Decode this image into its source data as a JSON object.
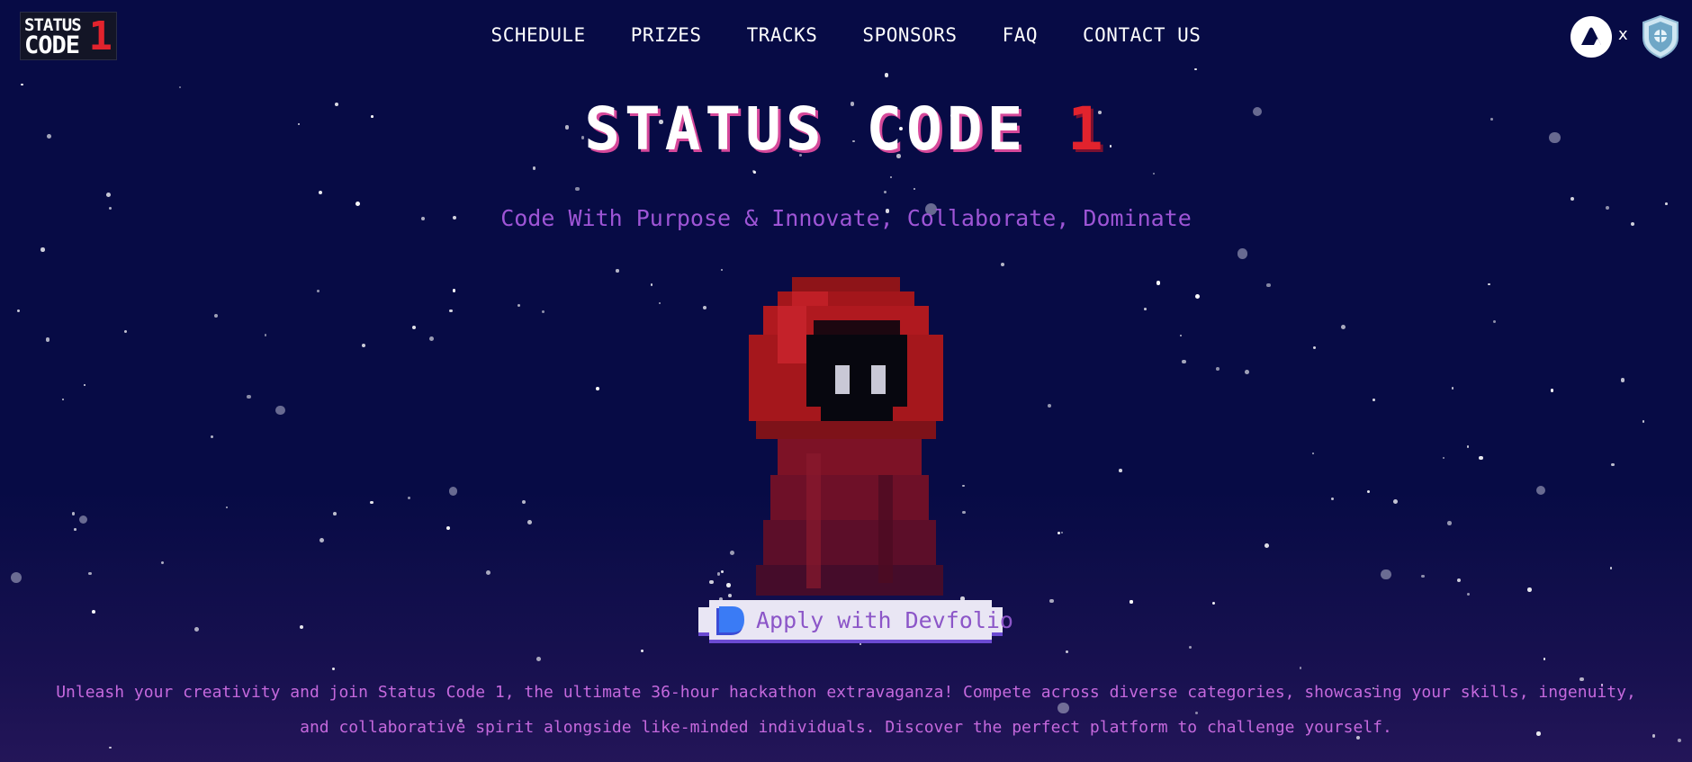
{
  "logo": {
    "line1": "STATUS",
    "line2": "CODE",
    "number": "1"
  },
  "nav": {
    "items": [
      {
        "label": "SCHEDULE"
      },
      {
        "label": "PRIZES"
      },
      {
        "label": "TRACKS"
      },
      {
        "label": "SPONSORS"
      },
      {
        "label": "FAQ"
      },
      {
        "label": "CONTACT US"
      }
    ]
  },
  "sponsors": {
    "separator": "x",
    "left_icon": "avalanche-logo-icon",
    "right_icon": "shield-crest-logo-icon"
  },
  "hero": {
    "title_text": "STATUS CODE",
    "title_number": "1",
    "subtitle": "Code With Purpose & Innovate, Collaborate, Dominate",
    "character_icon": "red-hooded-pixel-character"
  },
  "apply_button": {
    "label": "Apply with Devfolio",
    "icon": "devfolio-logo-icon"
  },
  "description": "Unleash your creativity and join Status Code 1, the ultimate 36-hour hackathon extravaganza! Compete across diverse categories, showcasing your skills, ingenuity, and collaborative spirit alongside like-minded individuals. Discover the perfect platform to challenge yourself.",
  "colors": {
    "background": "#070b45",
    "accent_red": "#e2232d",
    "subtitle_purple": "#9e55d6",
    "description_purple": "#c569dd",
    "button_bg": "#e9e6f4",
    "button_shadow": "#6b4bd2"
  }
}
